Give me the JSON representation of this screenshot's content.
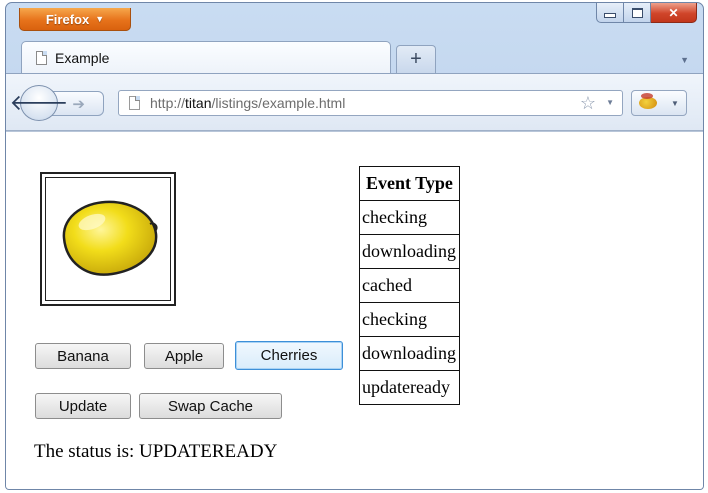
{
  "browser": {
    "menu_button": "Firefox",
    "tab_title": "Example",
    "new_tab_symbol": "+",
    "url_prefix": "http://",
    "url_host": "titan",
    "url_path": "/listings/example.html"
  },
  "page": {
    "image_icon": "lemon",
    "fruit_buttons": [
      "Banana",
      "Apple",
      "Cherries"
    ],
    "cache_buttons": [
      "Update",
      "Swap Cache"
    ],
    "status_text": "The status is: UPDATEREADY",
    "events_table": {
      "header": "Event Type",
      "rows": [
        "checking",
        "downloading",
        "cached",
        "checking",
        "downloading",
        "updateready"
      ]
    }
  },
  "colors": {
    "firefox_orange": "#e7731b",
    "close_red": "#d0452a",
    "focus_blue": "#3d8fd8",
    "lemon_yellow": "#f2dd1a"
  }
}
